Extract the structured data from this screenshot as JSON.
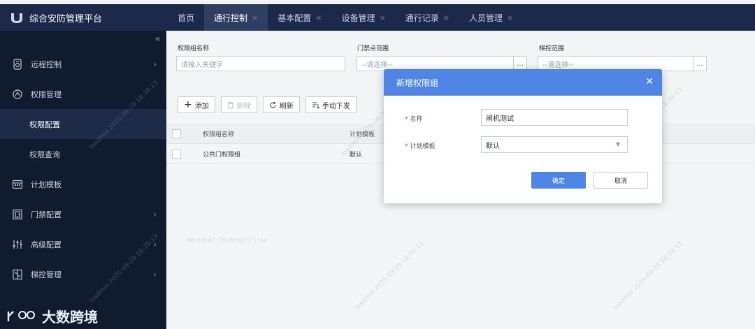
{
  "app": {
    "title": "综合安防管理平台"
  },
  "nav": {
    "tabs": [
      {
        "label": "首页"
      },
      {
        "label": "通行控制"
      },
      {
        "label": "基本配置"
      },
      {
        "label": "设备管理"
      },
      {
        "label": "通行记录"
      },
      {
        "label": "人员管理"
      }
    ],
    "close_glyph": "×"
  },
  "sidebar": {
    "items": [
      {
        "label": "远程控制"
      },
      {
        "label": "权限管理"
      },
      {
        "label": "权限配置"
      },
      {
        "label": "权限查询"
      },
      {
        "label": "计划模板"
      },
      {
        "label": "门禁配置"
      },
      {
        "label": "高级配置"
      },
      {
        "label": "梯控管理"
      }
    ],
    "logo_text": "大数跨境"
  },
  "filters": {
    "group_name_label": "权限组名称",
    "group_name_placeholder": "请输入关键字",
    "door_range_label": "门禁点范围",
    "door_range_value": "--请选择--",
    "elevator_range_label": "梯控范围",
    "elevator_range_value": "--请选择--",
    "dots": "..."
  },
  "toolbar": {
    "add": "添加",
    "delete": "删除",
    "refresh": "刷新",
    "manual_issue": "手动下发"
  },
  "table": {
    "headers": [
      "权限组名称",
      "计划模板"
    ],
    "rows": [
      {
        "name": "公共门权限组",
        "template": "默认"
      }
    ]
  },
  "modal": {
    "title": "新增权限组",
    "name_label": "名称",
    "name_value": "闸机测试",
    "template_label": "计划模板",
    "template_value": "默认",
    "confirm": "确定",
    "cancel": "取消",
    "required_mark": "*"
  },
  "watermarks": {
    "user": "loadmin 2025-09-29 18:39:13",
    "mac": "00:E0:4C:78:86:07:C1:3a"
  },
  "colors": {
    "accent": "#4f86e6",
    "topbar": "#1b2a4a",
    "sidebar": "#111b30"
  }
}
